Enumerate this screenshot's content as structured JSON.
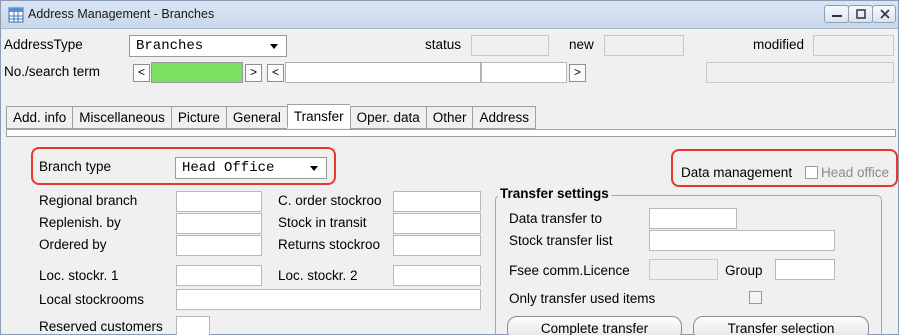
{
  "window": {
    "title": "Address Management - Branches",
    "minimize_icon": "minimize-icon",
    "maximize_icon": "maximize-icon",
    "close_icon": "close-icon"
  },
  "header": {
    "address_type_label": "AddressType",
    "address_type_value": "Branches",
    "status_label": "status",
    "status_value": "",
    "new_label": "new",
    "new_value": "",
    "modified_label": "modified",
    "modified_value": "",
    "search_label": "No./search term",
    "search_value": "",
    "search_text": "",
    "nav_prev": "<",
    "nav_next": ">",
    "nav_prev2": "<",
    "nav_next2": ">"
  },
  "tabs": [
    {
      "label": "Add. info"
    },
    {
      "label": "Miscellaneous"
    },
    {
      "label": "Picture"
    },
    {
      "label": "General"
    },
    {
      "label": "Transfer",
      "active": true
    },
    {
      "label": "Oper. data"
    },
    {
      "label": "Other"
    },
    {
      "label": "Address"
    }
  ],
  "transfer": {
    "branch_type_label": "Branch type",
    "branch_type_value": "Head Office",
    "data_management_label": "Data management",
    "head_office_label": "Head office",
    "head_office_checked": false,
    "regional_branch_label": "Regional branch",
    "replenish_by_label": "Replenish. by",
    "ordered_by_label": "Ordered by",
    "loc_stockr1_label": "Loc. stockr. 1",
    "local_stockrooms_label": "Local stockrooms",
    "reserved_customers_label": "Reserved customers",
    "c_order_stockroom_label": "C. order stockroo",
    "stock_in_transit_label": "Stock in transit",
    "returns_stockroom_label": "Returns stockroo",
    "loc_stockr2_label": "Loc. stockr. 2"
  },
  "transfer_settings": {
    "title": "Transfer settings",
    "data_transfer_to_label": "Data transfer to",
    "stock_transfer_list_label": "Stock transfer list",
    "fsee_licence_label": "Fsee comm.Licence",
    "group_label": "Group",
    "only_used_items_label": "Only transfer used items",
    "only_used_items_checked": false,
    "complete_transfer_button": "Complete transfer",
    "transfer_selection_button": "Transfer selection"
  },
  "colors": {
    "highlight_red": "#e8382b",
    "search_green": "#7ee061"
  }
}
